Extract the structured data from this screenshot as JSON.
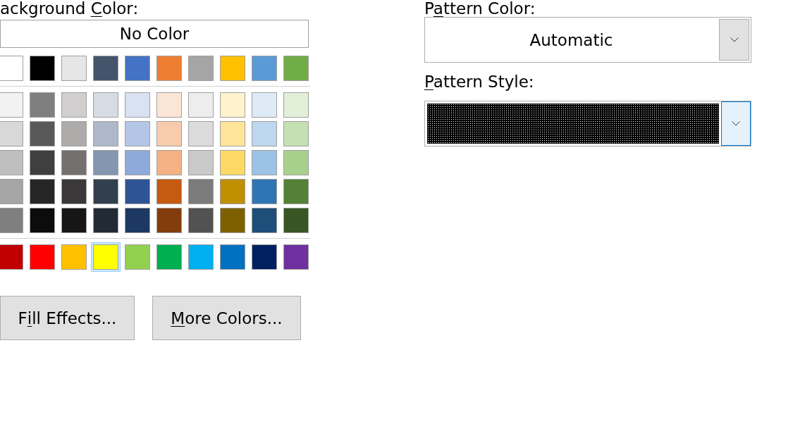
{
  "background_color": {
    "label": [
      {
        "text": "ackground ",
        "underline": false
      },
      {
        "text": "C",
        "underline": true
      },
      {
        "text": "olor:",
        "underline": false
      }
    ],
    "no_color_button": "No Color",
    "theme_colors": [
      {
        "color": "#ffffff",
        "selected": false
      },
      {
        "color": "#000000",
        "selected": false
      },
      {
        "color": "#e7e6e6",
        "selected": false
      },
      {
        "color": "#44546a",
        "selected": false
      },
      {
        "color": "#4472c4",
        "selected": false
      },
      {
        "color": "#ed7d31",
        "selected": false
      },
      {
        "color": "#a5a5a5",
        "selected": false
      },
      {
        "color": "#ffc000",
        "selected": false
      },
      {
        "color": "#5b9bd5",
        "selected": false
      },
      {
        "color": "#70ad47",
        "selected": false
      }
    ],
    "shade_rows": [
      {
        "swatches": [
          {
            "color": "#f2f2f2",
            "selected": false
          },
          {
            "color": "#7f7f7f",
            "selected": false
          },
          {
            "color": "#d0cece",
            "selected": false
          },
          {
            "color": "#d6dce4",
            "selected": false
          },
          {
            "color": "#d9e2f3",
            "selected": false
          },
          {
            "color": "#fbe5d5",
            "selected": false
          },
          {
            "color": "#ededed",
            "selected": false
          },
          {
            "color": "#fff2cc",
            "selected": false
          },
          {
            "color": "#deebf6",
            "selected": false
          },
          {
            "color": "#e2efd9",
            "selected": false
          }
        ]
      },
      {
        "swatches": [
          {
            "color": "#d8d8d8",
            "selected": false
          },
          {
            "color": "#595959",
            "selected": false
          },
          {
            "color": "#aeabab",
            "selected": false
          },
          {
            "color": "#adb9ca",
            "selected": false
          },
          {
            "color": "#b4c6e7",
            "selected": false
          },
          {
            "color": "#f7cbac",
            "selected": false
          },
          {
            "color": "#dbdbdb",
            "selected": false
          },
          {
            "color": "#fee599",
            "selected": false
          },
          {
            "color": "#bdd7ee",
            "selected": false
          },
          {
            "color": "#c5e0b3",
            "selected": false
          }
        ]
      },
      {
        "swatches": [
          {
            "color": "#bfbfbf",
            "selected": false
          },
          {
            "color": "#3f3f3f",
            "selected": false
          },
          {
            "color": "#757070",
            "selected": false
          },
          {
            "color": "#8496b0",
            "selected": false
          },
          {
            "color": "#8eaadb",
            "selected": false
          },
          {
            "color": "#f4b183",
            "selected": false
          },
          {
            "color": "#c9c9c9",
            "selected": false
          },
          {
            "color": "#ffd965",
            "selected": false
          },
          {
            "color": "#9cc3e5",
            "selected": false
          },
          {
            "color": "#a8d08d",
            "selected": false
          }
        ]
      },
      {
        "swatches": [
          {
            "color": "#a5a5a5",
            "selected": false
          },
          {
            "color": "#262626",
            "selected": false
          },
          {
            "color": "#3a3838",
            "selected": false
          },
          {
            "color": "#323f4f",
            "selected": false
          },
          {
            "color": "#2f5496",
            "selected": false
          },
          {
            "color": "#c55a11",
            "selected": false
          },
          {
            "color": "#7b7b7b",
            "selected": false
          },
          {
            "color": "#bf9000",
            "selected": false
          },
          {
            "color": "#2e75b5",
            "selected": false
          },
          {
            "color": "#538135",
            "selected": false
          }
        ]
      },
      {
        "swatches": [
          {
            "color": "#7f7f7f",
            "selected": false
          },
          {
            "color": "#0c0c0c",
            "selected": false
          },
          {
            "color": "#171616",
            "selected": false
          },
          {
            "color": "#222a35",
            "selected": false
          },
          {
            "color": "#1e3864",
            "selected": false
          },
          {
            "color": "#833c0b",
            "selected": false
          },
          {
            "color": "#525252",
            "selected": false
          },
          {
            "color": "#7f6000",
            "selected": false
          },
          {
            "color": "#1e4e79",
            "selected": false
          },
          {
            "color": "#375623",
            "selected": false
          }
        ]
      }
    ],
    "standard_colors": [
      {
        "color": "#c00000",
        "selected": false
      },
      {
        "color": "#ff0000",
        "selected": false
      },
      {
        "color": "#ffc000",
        "selected": false
      },
      {
        "color": "#ffff00",
        "selected": true
      },
      {
        "color": "#92d050",
        "selected": false
      },
      {
        "color": "#00b050",
        "selected": false
      },
      {
        "color": "#00b0f0",
        "selected": false
      },
      {
        "color": "#0070c0",
        "selected": false
      },
      {
        "color": "#002060",
        "selected": false
      },
      {
        "color": "#7030a0",
        "selected": false
      }
    ]
  },
  "buttons": [
    {
      "label": [
        {
          "text": "F",
          "underline": false
        },
        {
          "text": "i",
          "underline": true
        },
        {
          "text": "ll Effects...",
          "underline": false
        }
      ]
    },
    {
      "label": [
        {
          "text": "M",
          "underline": true
        },
        {
          "text": "ore Colors...",
          "underline": false
        }
      ]
    }
  ],
  "pattern_color": {
    "label": [
      {
        "text": "P",
        "underline": false
      },
      {
        "text": "a",
        "underline": true
      },
      {
        "text": "ttern Color:",
        "underline": false
      }
    ],
    "value": "Automatic",
    "focused": false
  },
  "pattern_style": {
    "label": [
      {
        "text": "P",
        "underline": true
      },
      {
        "text": "attern Style:",
        "underline": false
      }
    ],
    "focused": true
  }
}
